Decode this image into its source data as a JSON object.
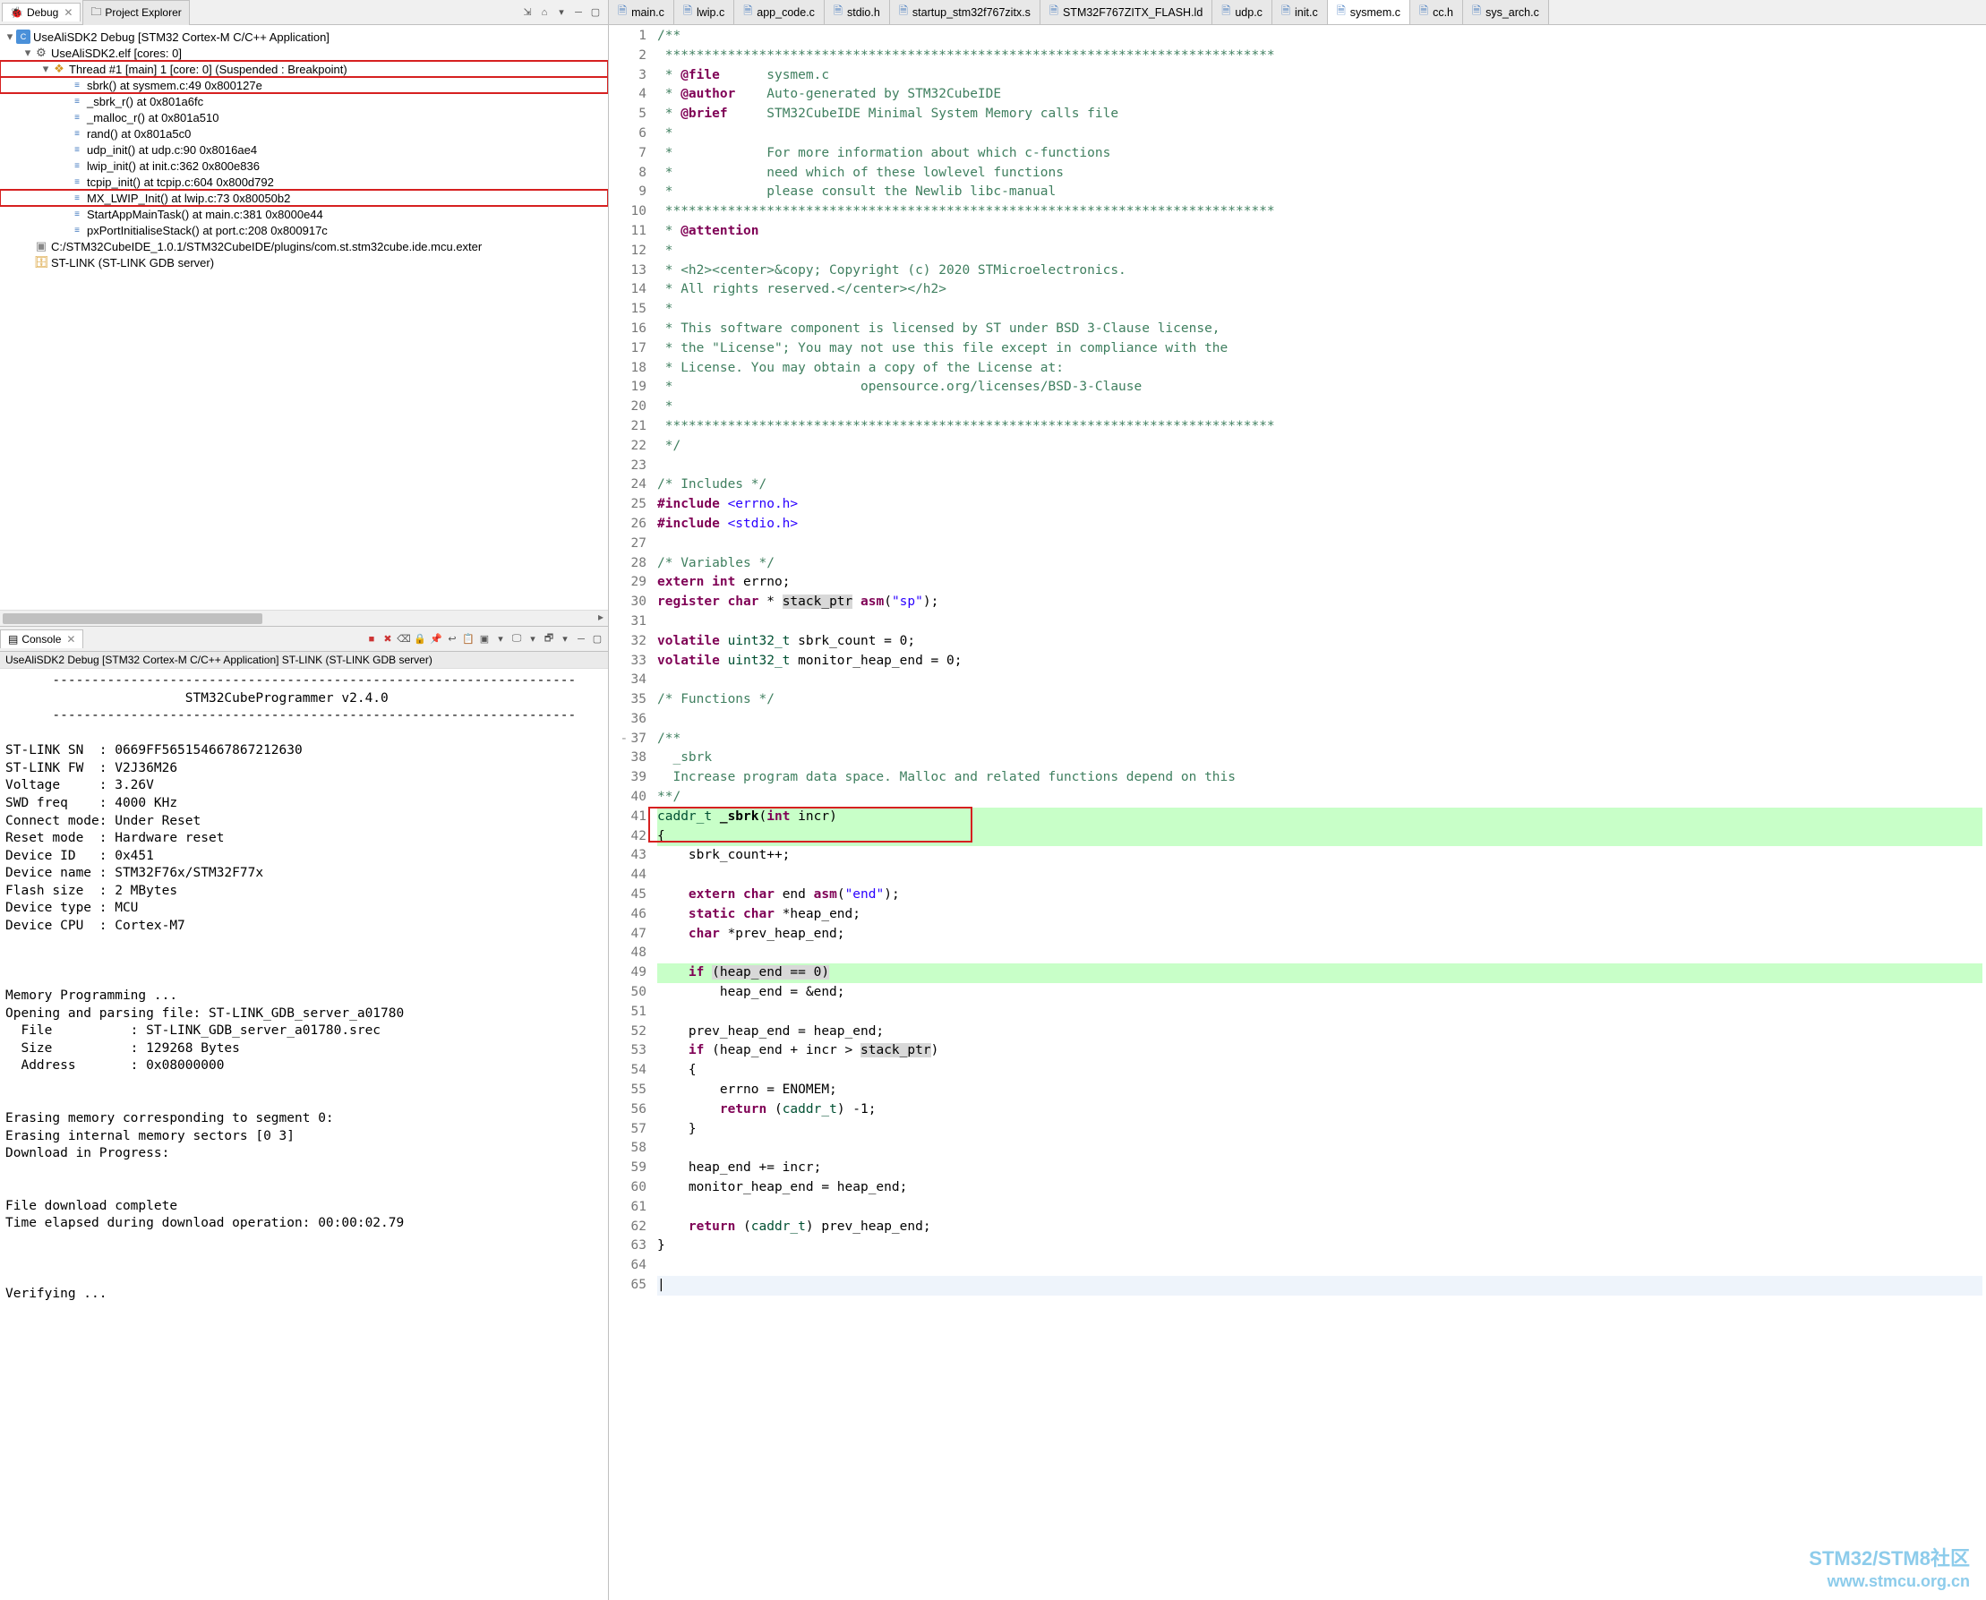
{
  "debug": {
    "tab_label": "Debug",
    "project_explorer_label": "Project Explorer",
    "tree": {
      "app": "UseAliSDK2 Debug [STM32 Cortex-M C/C++ Application]",
      "elf": "UseAliSDK2.elf [cores: 0]",
      "thread": "Thread #1 [main] 1 [core: 0] (Suspended : Breakpoint)",
      "stack": [
        "sbrk() at sysmem.c:49 0x800127e",
        "_sbrk_r() at 0x801a6fc",
        "_malloc_r() at 0x801a510",
        "rand() at 0x801a5c0",
        "udp_init() at udp.c:90 0x8016ae4",
        "lwip_init() at init.c:362 0x800e836",
        "tcpip_init() at tcpip.c:604 0x800d792",
        "MX_LWIP_Init() at lwip.c:73 0x80050b2",
        "StartAppMainTask() at main.c:381 0x8000e44",
        "pxPortInitialiseStack() at port.c:208 0x800917c"
      ],
      "gdb_path": "C:/STM32CubeIDE_1.0.1/STM32CubeIDE/plugins/com.st.stm32cube.ide.mcu.exter",
      "stlink": "ST-LINK (ST-LINK GDB server)"
    }
  },
  "console": {
    "tab_label": "Console",
    "subhead": "UseAliSDK2 Debug [STM32 Cortex-M C/C++ Application] ST-LINK (ST-LINK GDB server)",
    "body": "      -------------------------------------------------------------------\n                       STM32CubeProgrammer v2.4.0                  \n      -------------------------------------------------------------------\n\nST-LINK SN  : 0669FF565154667867212630\nST-LINK FW  : V2J36M26\nVoltage     : 3.26V\nSWD freq    : 4000 KHz\nConnect mode: Under Reset\nReset mode  : Hardware reset\nDevice ID   : 0x451\nDevice name : STM32F76x/STM32F77x\nFlash size  : 2 MBytes\nDevice type : MCU\nDevice CPU  : Cortex-M7\n\n\n\nMemory Programming ...\nOpening and parsing file: ST-LINK_GDB_server_a01780\n  File          : ST-LINK_GDB_server_a01780.srec\n  Size          : 129268 Bytes\n  Address       : 0x08000000 \n\n\nErasing memory corresponding to segment 0:\nErasing internal memory sectors [0 3]\nDownload in Progress:\n\n\nFile download complete\nTime elapsed during download operation: 00:00:02.79\n\n\n\nVerifying ..."
  },
  "editor": {
    "tabs": [
      {
        "label": "main.c"
      },
      {
        "label": "lwip.c"
      },
      {
        "label": "app_code.c"
      },
      {
        "label": "stdio.h"
      },
      {
        "label": "startup_stm32f767zitx.s"
      },
      {
        "label": "STM32F767ZITX_FLASH.ld"
      },
      {
        "label": "udp.c"
      },
      {
        "label": "init.c"
      },
      {
        "label": "sysmem.c"
      },
      {
        "label": "cc.h"
      },
      {
        "label": "sys_arch.c"
      }
    ],
    "lines": [
      {
        "n": 1,
        "html": "<span class='c-comment'>/**</span>"
      },
      {
        "n": 2,
        "html": "<span class='c-comment'> ******************************************************************************</span>"
      },
      {
        "n": 3,
        "html": "<span class='c-comment'> * <span class='c-keyword'>@file</span>      sysmem.c</span>"
      },
      {
        "n": 4,
        "html": "<span class='c-comment'> * <span class='c-keyword'>@author</span>    Auto-generated by STM32CubeIDE</span>"
      },
      {
        "n": 5,
        "html": "<span class='c-comment'> * <span class='c-keyword'>@brief</span>     STM32CubeIDE Minimal System Memory calls file</span>"
      },
      {
        "n": 6,
        "html": "<span class='c-comment'> *</span>"
      },
      {
        "n": 7,
        "html": "<span class='c-comment'> *            For more information about which c-functions</span>"
      },
      {
        "n": 8,
        "html": "<span class='c-comment'> *            need which of these lowlevel functions</span>"
      },
      {
        "n": 9,
        "html": "<span class='c-comment'> *            please consult the Newlib libc-manual</span>"
      },
      {
        "n": 10,
        "html": "<span class='c-comment'> ******************************************************************************</span>"
      },
      {
        "n": 11,
        "html": "<span class='c-comment'> * <span class='c-keyword'>@attention</span></span>"
      },
      {
        "n": 12,
        "html": "<span class='c-comment'> *</span>"
      },
      {
        "n": 13,
        "html": "<span class='c-comment'> * &lt;h2&gt;&lt;center&gt;&amp;copy; Copyright (c) 2020 STMicroelectronics.</span>"
      },
      {
        "n": 14,
        "html": "<span class='c-comment'> * All rights reserved.&lt;/center&gt;&lt;/h2&gt;</span>"
      },
      {
        "n": 15,
        "html": "<span class='c-comment'> *</span>"
      },
      {
        "n": 16,
        "html": "<span class='c-comment'> * This software component is licensed by ST under BSD 3-Clause license,</span>"
      },
      {
        "n": 17,
        "html": "<span class='c-comment'> * the \"License\"; You may not use this file except in compliance with the</span>"
      },
      {
        "n": 18,
        "html": "<span class='c-comment'> * License. You may obtain a copy of the License at:</span>"
      },
      {
        "n": 19,
        "html": "<span class='c-comment'> *                        opensource.org/licenses/BSD-3-Clause</span>"
      },
      {
        "n": 20,
        "html": "<span class='c-comment'> *</span>"
      },
      {
        "n": 21,
        "html": "<span class='c-comment'> ******************************************************************************</span>"
      },
      {
        "n": 22,
        "html": "<span class='c-comment'> */</span>"
      },
      {
        "n": 23,
        "html": ""
      },
      {
        "n": 24,
        "html": "<span class='c-comment'>/* Includes */</span>"
      },
      {
        "n": 25,
        "html": "<span class='c-keyword'>#include</span> <span class='c-string'>&lt;errno.h&gt;</span>"
      },
      {
        "n": 26,
        "html": "<span class='c-keyword'>#include</span> <span class='c-string'>&lt;stdio.h&gt;</span>"
      },
      {
        "n": 27,
        "html": ""
      },
      {
        "n": 28,
        "html": "<span class='c-comment'>/* Variables */</span>"
      },
      {
        "n": 29,
        "html": "<span class='c-keyword'>extern</span> <span class='c-keyword'>int</span> errno;"
      },
      {
        "n": 30,
        "html": "<span class='c-keyword'>register</span> <span class='c-keyword'>char</span> * <span class='hl-grey'>stack_ptr</span> <span class='c-keyword'>asm</span>(<span class='c-string'>\"sp\"</span>);"
      },
      {
        "n": 31,
        "html": ""
      },
      {
        "n": 32,
        "html": "<span class='c-keyword'>volatile</span> <span class='c-type'>uint32_t</span> sbrk_count = 0;"
      },
      {
        "n": 33,
        "html": "<span class='c-keyword'>volatile</span> <span class='c-type'>uint32_t</span> monitor_heap_end = 0;"
      },
      {
        "n": 34,
        "html": ""
      },
      {
        "n": 35,
        "html": "<span class='c-comment'>/* Functions */</span>"
      },
      {
        "n": 36,
        "html": ""
      },
      {
        "n": 37,
        "mark": "-",
        "html": "<span class='c-comment'>/**</span>"
      },
      {
        "n": 38,
        "html": "<span class='c-comment'>  _sbrk</span>"
      },
      {
        "n": 39,
        "html": "<span class='c-comment'>  Increase program data space. Malloc and related functions depend on this</span>"
      },
      {
        "n": 40,
        "html": "<span class='c-comment'>**/</span>"
      },
      {
        "n": 41,
        "green": true,
        "html": "<span class='c-type'>caddr_t</span> <span style='font-weight:bold'>_sbrk</span>(<span class='c-keyword'>int</span> incr)"
      },
      {
        "n": 42,
        "green": true,
        "html": "{"
      },
      {
        "n": 43,
        "html": "    sbrk_count++;"
      },
      {
        "n": 44,
        "html": ""
      },
      {
        "n": 45,
        "html": "    <span class='c-keyword'>extern</span> <span class='c-keyword'>char</span> end <span class='c-keyword'>asm</span>(<span class='c-string'>\"end\"</span>);"
      },
      {
        "n": 46,
        "html": "    <span class='c-keyword'>static</span> <span class='c-keyword'>char</span> *heap_end;"
      },
      {
        "n": 47,
        "html": "    <span class='c-keyword'>char</span> *prev_heap_end;"
      },
      {
        "n": 48,
        "html": ""
      },
      {
        "n": 49,
        "green": true,
        "html": "    <span class='c-keyword'>if</span> <span class='hl-grey'>(heap_end == 0)</span>"
      },
      {
        "n": 50,
        "html": "        heap_end = &amp;end;"
      },
      {
        "n": 51,
        "html": ""
      },
      {
        "n": 52,
        "html": "    prev_heap_end = heap_end;"
      },
      {
        "n": 53,
        "html": "    <span class='c-keyword'>if</span> (heap_end + incr &gt; <span class='hl-grey'>stack_ptr</span>)"
      },
      {
        "n": 54,
        "html": "    {"
      },
      {
        "n": 55,
        "html": "        errno = ENOMEM;"
      },
      {
        "n": 56,
        "html": "        <span class='c-keyword'>return</span> (<span class='c-type'>caddr_t</span>) -1;"
      },
      {
        "n": 57,
        "html": "    }"
      },
      {
        "n": 58,
        "html": ""
      },
      {
        "n": 59,
        "html": "    heap_end += incr;"
      },
      {
        "n": 60,
        "html": "    monitor_heap_end = heap_end;"
      },
      {
        "n": 61,
        "html": ""
      },
      {
        "n": 62,
        "html": "    <span class='c-keyword'>return</span> (<span class='c-type'>caddr_t</span>) prev_heap_end;"
      },
      {
        "n": 63,
        "html": "}"
      },
      {
        "n": 64,
        "html": ""
      },
      {
        "n": 65,
        "cursor": true,
        "html": ""
      }
    ]
  },
  "watermark": {
    "line1": "STM32/STM8社区",
    "line2": "www.stmcu.org.cn"
  }
}
